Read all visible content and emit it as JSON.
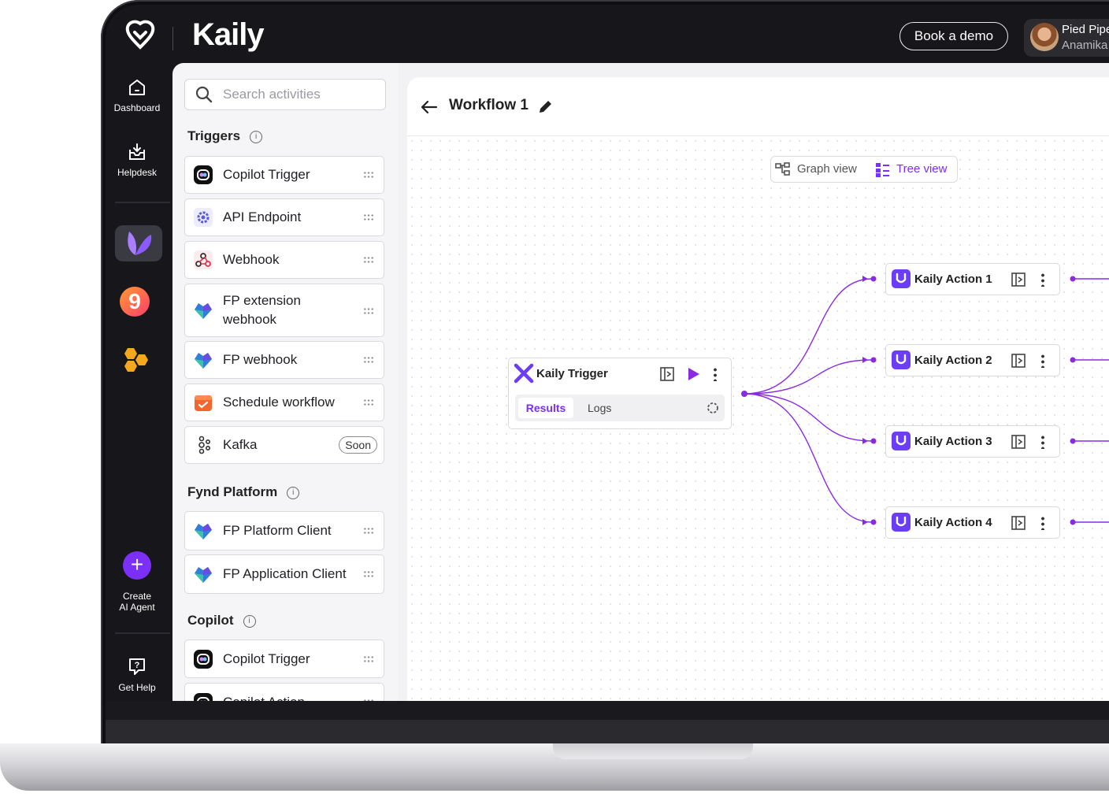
{
  "brand": {
    "name": "Kaily"
  },
  "header": {
    "book_demo": "Book a demo",
    "user_org": "Pied Piper",
    "user_name": "Anamika"
  },
  "rail": {
    "dashboard": "Dashboard",
    "helpdesk": "Helpdesk",
    "create_line1": "Create",
    "create_line2": "AI Agent",
    "help": "Get Help"
  },
  "panel": {
    "search_placeholder": "Search activities",
    "sections": {
      "triggers": "Triggers",
      "fynd": "Fynd Platform",
      "copilot": "Copilot"
    },
    "triggers": [
      {
        "label": "Copilot Trigger",
        "icon": "copilot-icon"
      },
      {
        "label": "API Endpoint",
        "icon": "gear-icon"
      },
      {
        "label": "Webhook",
        "icon": "webhook-icon"
      },
      {
        "label": "FP extension webhook",
        "icon": "fynd-icon"
      },
      {
        "label": "FP webhook",
        "icon": "fynd-icon"
      },
      {
        "label": "Schedule workflow",
        "icon": "calendar-icon"
      },
      {
        "label": "Kafka",
        "icon": "kafka-icon",
        "badge": "Soon"
      }
    ],
    "fynd": [
      {
        "label": "FP Platform Client",
        "icon": "fynd-icon"
      },
      {
        "label": "FP Application Client",
        "icon": "fynd-icon"
      }
    ],
    "copilot": [
      {
        "label": "Copilot Trigger",
        "icon": "copilot-icon"
      },
      {
        "label": "Copilot Action",
        "icon": "copilot-icon"
      }
    ]
  },
  "workflow": {
    "title": "Workflow 1",
    "views": {
      "graph": "Graph view",
      "tree": "Tree view",
      "active": "tree"
    },
    "trigger": {
      "label": "Kaily Trigger",
      "tab_results": "Results",
      "tab_logs": "Logs"
    },
    "actions": [
      "Kaily Action 1",
      "Kaily Action 2",
      "Kaily Action 3",
      "Kaily Action 4"
    ]
  },
  "colors": {
    "accent": "#7b2ff7",
    "rail_bg": "#17171b",
    "node_icon": "#6b3df5"
  }
}
